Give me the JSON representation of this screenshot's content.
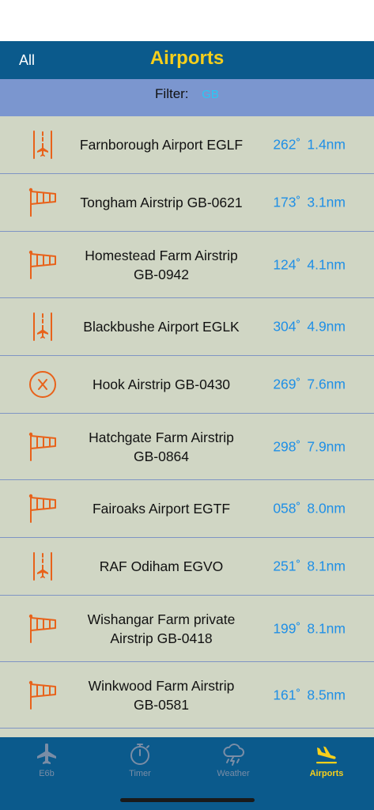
{
  "nav": {
    "back_label": "All",
    "title": "Airports"
  },
  "filter": {
    "label": "Filter:",
    "value": "GB"
  },
  "airports": [
    {
      "icon": "runway-icon",
      "name_lines": [
        "Farnborough Airport  EGLF"
      ],
      "bearing": "262˚",
      "distance": "1.4nm"
    },
    {
      "icon": "windsock-icon",
      "name_lines": [
        "Tongham Airstrip  GB-0621"
      ],
      "bearing": "173˚",
      "distance": "3.1nm"
    },
    {
      "icon": "windsock-icon",
      "name_lines": [
        "Homestead Farm Airstrip",
        "GB-0942"
      ],
      "bearing": "124˚",
      "distance": "4.1nm"
    },
    {
      "icon": "runway-icon",
      "name_lines": [
        "Blackbushe Airport  EGLK"
      ],
      "bearing": "304˚",
      "distance": "4.9nm"
    },
    {
      "icon": "closed-airfield-icon",
      "name_lines": [
        "Hook Airstrip  GB-0430"
      ],
      "bearing": "269˚",
      "distance": "7.6nm"
    },
    {
      "icon": "windsock-icon",
      "name_lines": [
        "Hatchgate Farm Airstrip",
        "GB-0864"
      ],
      "bearing": "298˚",
      "distance": "7.9nm"
    },
    {
      "icon": "windsock-icon",
      "name_lines": [
        "Fairoaks Airport  EGTF"
      ],
      "bearing": "058˚",
      "distance": "8.0nm"
    },
    {
      "icon": "runway-icon",
      "name_lines": [
        "RAF Odiham  EGVO"
      ],
      "bearing": "251˚",
      "distance": "8.1nm"
    },
    {
      "icon": "windsock-icon",
      "name_lines": [
        "Wishangar Farm private",
        "Airstrip  GB-0418"
      ],
      "bearing": "199˚",
      "distance": "8.1nm"
    },
    {
      "icon": "windsock-icon",
      "name_lines": [
        "Winkwood Farm Airstrip",
        "GB-0581"
      ],
      "bearing": "161˚",
      "distance": "8.5nm"
    }
  ],
  "tabs": [
    {
      "id": "e6b",
      "label": "E6b",
      "icon": "airplane-icon"
    },
    {
      "id": "timer",
      "label": "Timer",
      "icon": "stopwatch-icon"
    },
    {
      "id": "weather",
      "label": "Weather",
      "icon": "storm-cloud-icon"
    },
    {
      "id": "airports",
      "label": "Airports",
      "icon": "airplane-landing-icon"
    }
  ],
  "active_tab": "airports",
  "colors": {
    "nav_background": "#0b5a8c",
    "title_yellow": "#f7cf1b",
    "filter_background": "#7b96cf",
    "filter_value": "#29c8f5",
    "list_background": "#d0d6c4",
    "icon_orange": "#e8621a",
    "info_blue": "#1f8fe6",
    "tab_inactive": "#7a8da6"
  }
}
